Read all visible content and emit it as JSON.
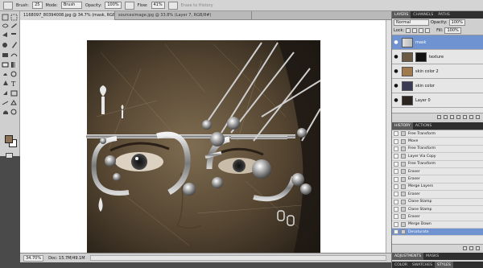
{
  "options_bar": {
    "brush_label": "Brush:",
    "brush_size": "25",
    "mode_label": "Mode:",
    "mode_value": "Brush",
    "opacity_label": "Opacity:",
    "opacity_value": "100%",
    "flow_label": "Flow:",
    "flow_value": "41%",
    "erase_history_label": "Erase to History"
  },
  "tabs": [
    {
      "label": "1168097_80394008.jpg @ 34.7% (mask, RGB/8*)"
    },
    {
      "label": "sourcesimage.jpg @ 33.8% (Layer 7, RGB/8#)"
    }
  ],
  "status": {
    "zoom": "34.70%",
    "doc_size": "Doc: 15.7M/49.1M"
  },
  "layers_panel": {
    "tabs": [
      "LAYERS",
      "CHANNELS",
      "PATHS"
    ],
    "blend_mode": "Normal",
    "opacity_label": "Opacity:",
    "opacity_value": "100%",
    "lock_label": "Lock:",
    "fill_label": "Fill:",
    "fill_value": "100%",
    "layers": [
      {
        "name": "mask",
        "selected": true
      },
      {
        "name": "texture",
        "selected": false
      },
      {
        "name": "skin color 2",
        "selected": false
      },
      {
        "name": "skin color",
        "selected": false
      },
      {
        "name": "Layer 0",
        "selected": false
      }
    ]
  },
  "history_panel": {
    "tabs": [
      "HISTORY",
      "ACTIONS"
    ],
    "items": [
      "Free Transform",
      "Move",
      "Free Transform",
      "Layer Via Copy",
      "Free Transform",
      "Eraser",
      "Eraser",
      "Merge Layers",
      "Eraser",
      "Clone Stamp",
      "Clone Stamp",
      "Eraser",
      "Merge Down",
      "Desaturate"
    ],
    "selected_index": 13
  },
  "bottom_tabs": {
    "row1": [
      "ADJUSTMENTS",
      "MASKS"
    ],
    "row2": [
      "COLOR",
      "SWATCHES",
      "STYLES"
    ]
  },
  "colors": {
    "foreground": "#8e7352",
    "background": "#ffffff",
    "selection": "#6e93d0"
  }
}
